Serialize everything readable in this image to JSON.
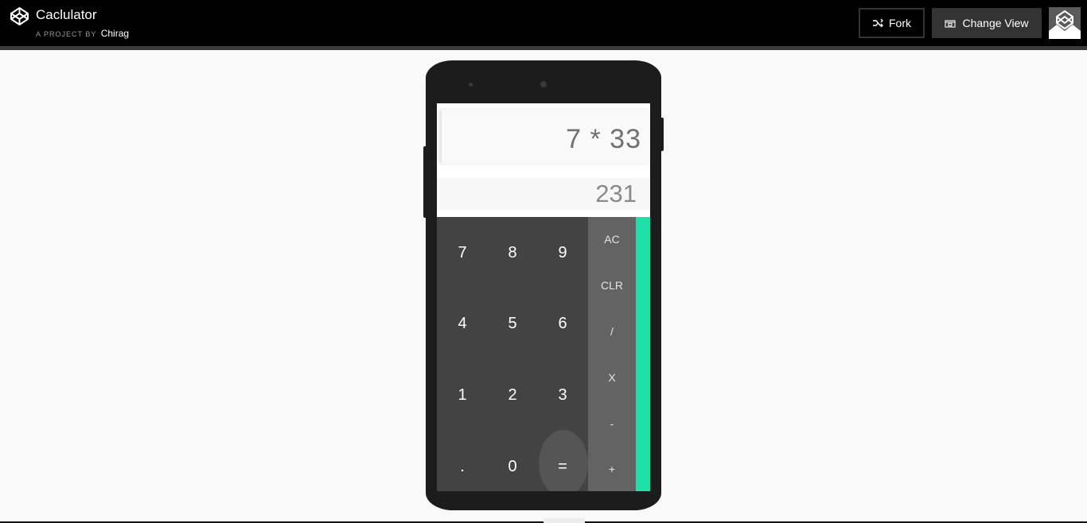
{
  "header": {
    "title": "Caclulator",
    "byline_prefix": "A PROJECT BY",
    "author": "Chirag",
    "fork_label": "Fork",
    "change_view_label": "Change View",
    "logo_icon": "codepen-logo-icon",
    "fork_icon": "fork-icon",
    "change_view_icon": "change-view-icon"
  },
  "calculator": {
    "expression": "7 * 33",
    "result": "231",
    "digit_rows": [
      [
        "7",
        "8",
        "9"
      ],
      [
        "4",
        "5",
        "6"
      ],
      [
        "1",
        "2",
        "3"
      ],
      [
        ".",
        "0",
        "="
      ]
    ],
    "operators": [
      "AC",
      "CLR",
      "/",
      "X",
      "-",
      "+"
    ],
    "accent_color": "#1de1a9"
  }
}
